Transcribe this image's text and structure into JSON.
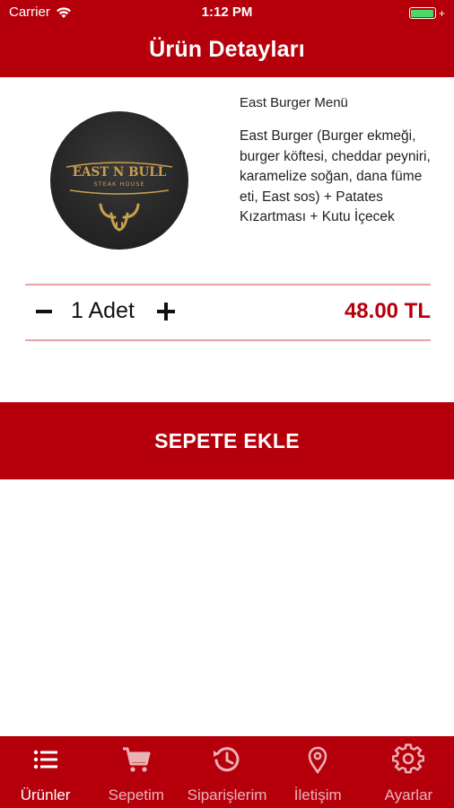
{
  "status_bar": {
    "carrier": "Carrier",
    "time": "1:12 PM",
    "battery_color": "#4cd964"
  },
  "header": {
    "title": "Ürün Detayları",
    "background": "#b5000c"
  },
  "product": {
    "name": "East Burger Menü",
    "description": "East Burger (Burger ekmeği, burger köftesi, cheddar peyniri, karamelize soğan, dana füme eti, East sos) + Patates Kızartması + Kutu İçecek",
    "logo": {
      "brand": "EAST N BULL",
      "subtitle": "STEAK HOUSE",
      "icon": "bull-horns-icon"
    }
  },
  "quantity": {
    "minus_icon": "minus-icon",
    "label": "1 Adet",
    "plus_icon": "plus-icon"
  },
  "price": "48.00 TL",
  "add_to_cart_label": "SEPETE EKLE",
  "tabs": [
    {
      "label": "Ürünler",
      "icon": "list-icon",
      "active": true
    },
    {
      "label": "Sepetim",
      "icon": "cart-icon",
      "active": false
    },
    {
      "label": "Siparişlerim",
      "icon": "history-icon",
      "active": false
    },
    {
      "label": "İletişim",
      "icon": "location-pin-icon",
      "active": false
    },
    {
      "label": "Ayarlar",
      "icon": "gear-icon",
      "active": false
    }
  ],
  "colors": {
    "accent": "#b5000c",
    "divider": "#e6a3a7",
    "logo_gold": "#c9a04b"
  }
}
